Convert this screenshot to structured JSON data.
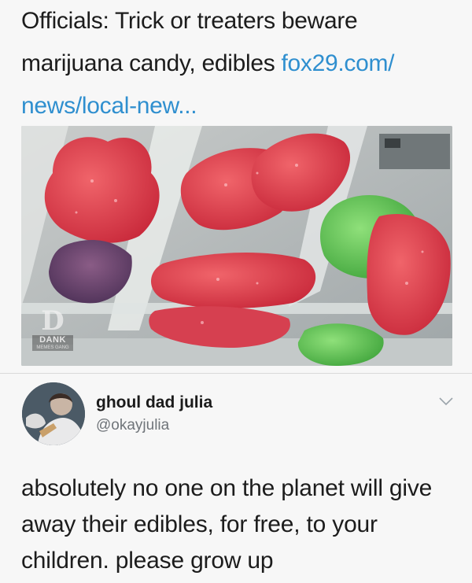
{
  "headline": {
    "text": "Officials: Trick or treaters beware marijuana candy, edibles ",
    "link": "fox29.com/ news/local-new..."
  },
  "media": {
    "description_icon": "candy-photo",
    "watermark": {
      "mark": "D",
      "word": "DANK",
      "sub": "MEMES GANG"
    }
  },
  "tweet": {
    "author_name": "ghoul dad julia",
    "author_handle": "@okayjulia",
    "avatar_icon": "avatar-photo",
    "menu_icon": "chevron-down-icon",
    "body": "absolutely no one on the planet will give away their edibles, for free, to your children. please grow up"
  },
  "colors": {
    "link": "#2f8fcf",
    "text": "#1c1c1c",
    "muted": "#6f7479",
    "background": "#f7f7f7"
  }
}
